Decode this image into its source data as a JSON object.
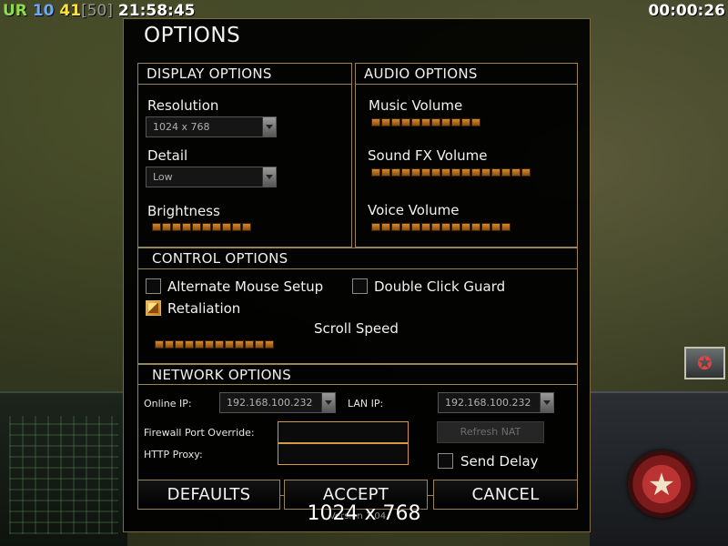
{
  "hud": {
    "ur": "UR",
    "v10": "10",
    "v41": "41",
    "v50": "[50]",
    "clock": "21:58:45",
    "timer": "00:00:26"
  },
  "dialog": {
    "title": "OPTIONS",
    "display": {
      "header": "DISPLAY OPTIONS",
      "resolution_label": "Resolution",
      "resolution_value": "1024 x 768",
      "detail_label": "Detail",
      "detail_value": "Low",
      "brightness_label": "Brightness",
      "brightness_level": 0.5
    },
    "audio": {
      "header": "AUDIO OPTIONS",
      "music_label": "Music Volume",
      "music_level": 0.55,
      "sfx_label": "Sound FX Volume",
      "sfx_level": 0.8,
      "voice_label": "Voice Volume",
      "voice_level": 0.7
    },
    "control": {
      "header": "CONTROL OPTIONS",
      "alt_mouse_label": "Alternate Mouse Setup",
      "alt_mouse_checked": false,
      "double_click_label": "Double Click Guard",
      "double_click_checked": false,
      "retaliation_label": "Retaliation",
      "retaliation_checked": true,
      "scroll_label": "Scroll Speed",
      "scroll_level": 0.6
    },
    "network": {
      "header": "NETWORK OPTIONS",
      "online_ip_label": "Online IP:",
      "online_ip_value": "192.168.100.232",
      "lan_ip_label": "LAN IP:",
      "lan_ip_value": "192.168.100.232",
      "firewall_label": "Firewall Port Override:",
      "firewall_value": "",
      "proxy_label": "HTTP Proxy:",
      "proxy_value": "",
      "refresh_nat_label": "Refresh NAT",
      "send_delay_label": "Send Delay",
      "send_delay_checked": false
    },
    "buttons": {
      "defaults": "DEFAULTS",
      "accept": "ACCEPT",
      "cancel": "CANCEL"
    },
    "version": "Version 1.04"
  },
  "overlay_resolution": "1024 x 768",
  "colors": {
    "accent_border": "#9a8550",
    "slider_fill": "#d88a2a",
    "textfield_border": "#d69a3c"
  }
}
